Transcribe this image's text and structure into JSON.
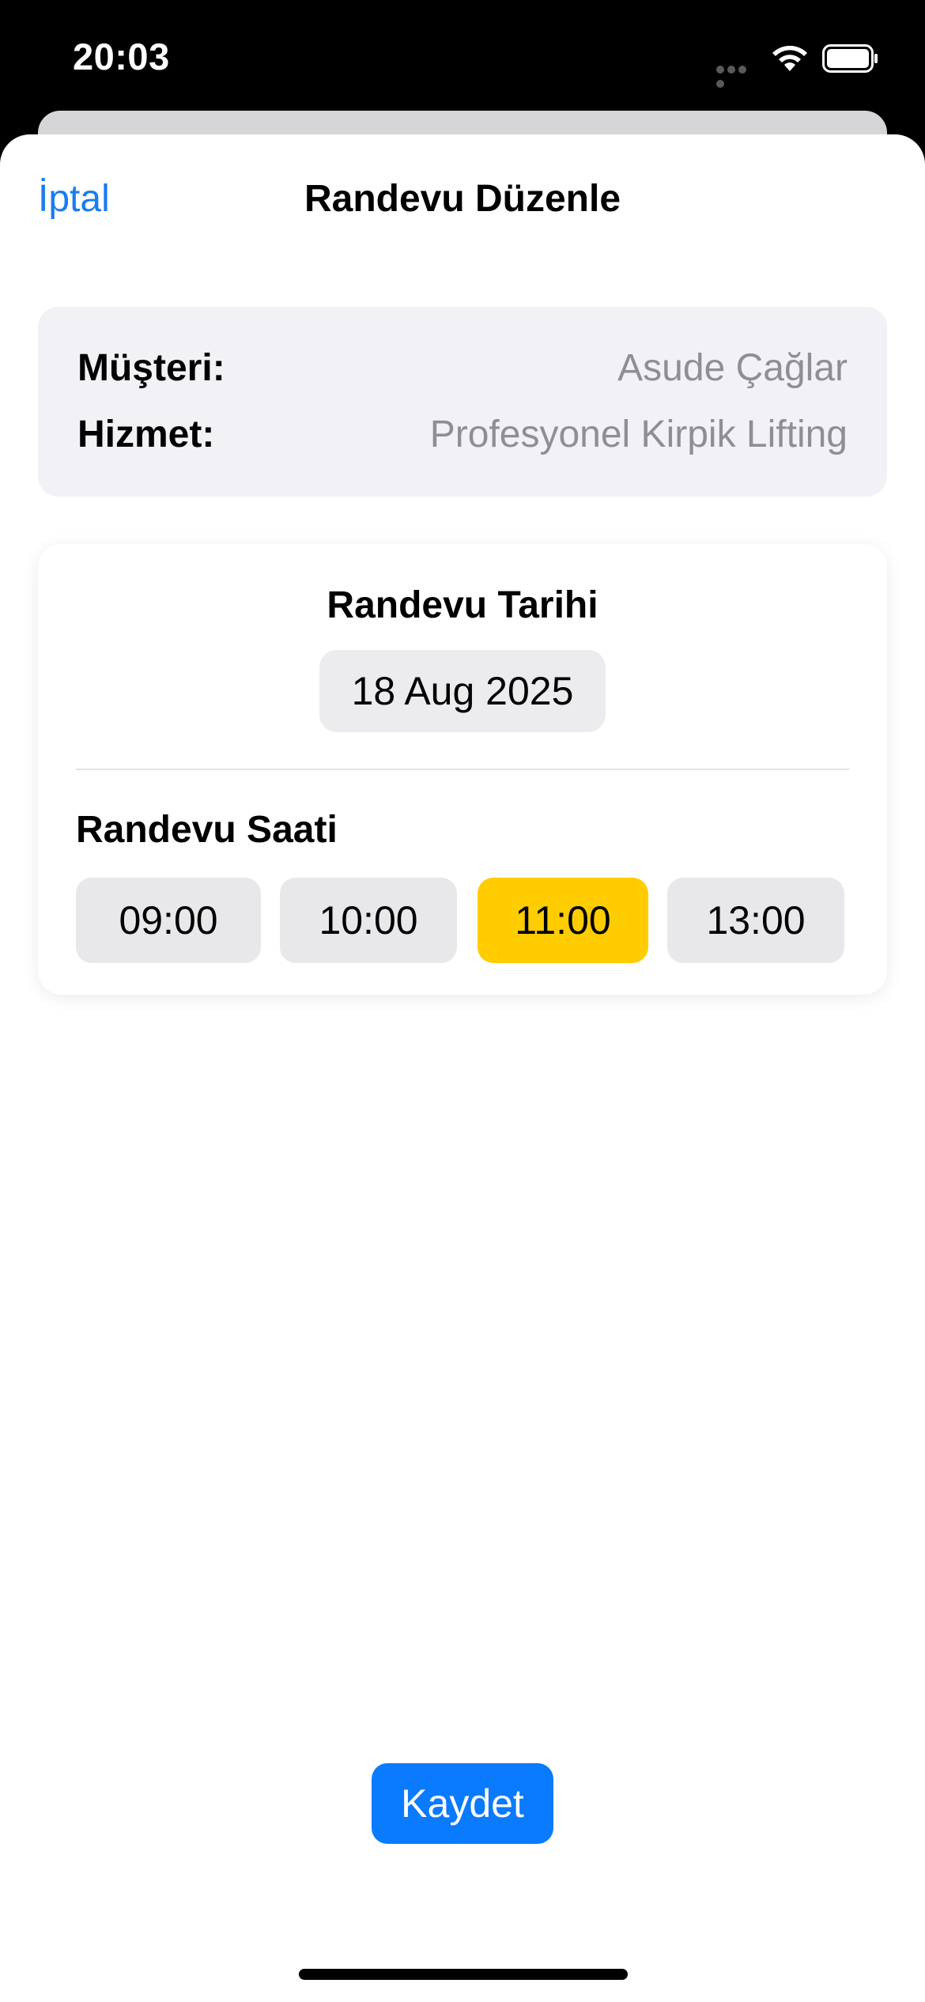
{
  "status_bar": {
    "time": "20:03",
    "icons": [
      "signal-dots-icon",
      "wifi-icon",
      "battery-icon"
    ]
  },
  "nav": {
    "cancel_label": "İptal",
    "title": "Randevu Düzenle"
  },
  "info": {
    "customer_label": "Müşteri:",
    "customer_value": "Asude Çağlar",
    "service_label": "Hizmet:",
    "service_value": "Profesyonel Kirpik Lifting"
  },
  "appointment": {
    "date_title": "Randevu Tarihi",
    "date_value": "18 Aug 2025",
    "time_title": "Randevu Saati",
    "slots": [
      {
        "label": "09:00",
        "selected": false
      },
      {
        "label": "10:00",
        "selected": false
      },
      {
        "label": "11:00",
        "selected": true
      },
      {
        "label": "13:00",
        "selected": false
      }
    ]
  },
  "actions": {
    "save_label": "Kaydet"
  },
  "colors": {
    "accent": "#0a7aff",
    "link": "#1a7cf0",
    "selected_slot": "#ffcc00",
    "slot_bg": "#e8e8ea",
    "info_bg": "#f1f1f6",
    "secondary_text": "#8e8e93"
  }
}
